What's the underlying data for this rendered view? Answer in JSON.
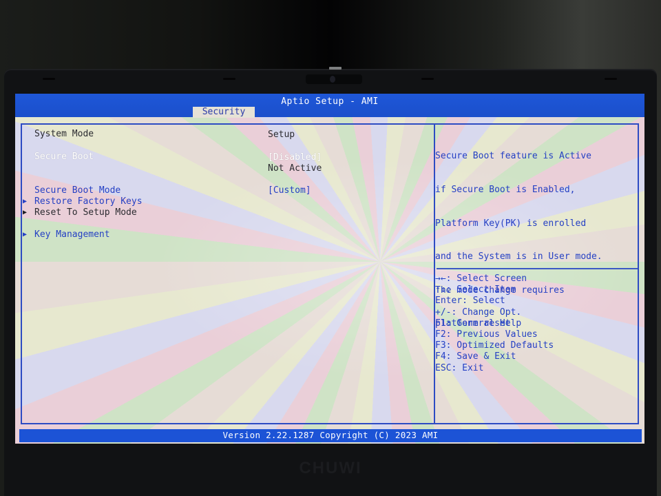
{
  "window": {
    "title": "Aptio Setup - AMI",
    "active_tab": "Security"
  },
  "settings": {
    "system_mode": {
      "label": "System Mode",
      "value": "Setup"
    },
    "secure_boot": {
      "label": "Secure Boot",
      "value": "[Disabled]",
      "status": "Not Active"
    },
    "secure_boot_mode": {
      "label": "Secure Boot Mode",
      "value": "[Custom]"
    },
    "restore_factory_keys": {
      "label": "Restore Factory Keys",
      "icon": "submenu-arrow-icon"
    },
    "reset_to_setup_mode": {
      "label": "Reset To Setup Mode",
      "icon": "submenu-arrow-icon"
    },
    "key_management": {
      "label": "Key Management",
      "icon": "submenu-arrow-icon"
    }
  },
  "help": {
    "lines": [
      "Secure Boot feature is Active",
      "if Secure Boot is Enabled,",
      "Platform Key(PK) is enrolled",
      "and the System is in User mode.",
      "The mode change requires",
      "platform reset"
    ]
  },
  "keys": [
    "→←: Select Screen",
    "↑↓: Select Item",
    "Enter: Select",
    "+/-: Change Opt.",
    "F1: General Help",
    "F2: Previous Values",
    "F3: Optimized Defaults",
    "F4: Save & Exit",
    "ESC: Exit"
  ],
  "footer": {
    "version": "Version 2.22.1287 Copyright (C) 2023 AMI"
  },
  "device": {
    "brand": "CHUWI"
  },
  "colors": {
    "title_bar": "#1e57d8",
    "text_blue": "#2540c4",
    "frame": "#2d4bc3",
    "selected_text": "#ffffff"
  }
}
